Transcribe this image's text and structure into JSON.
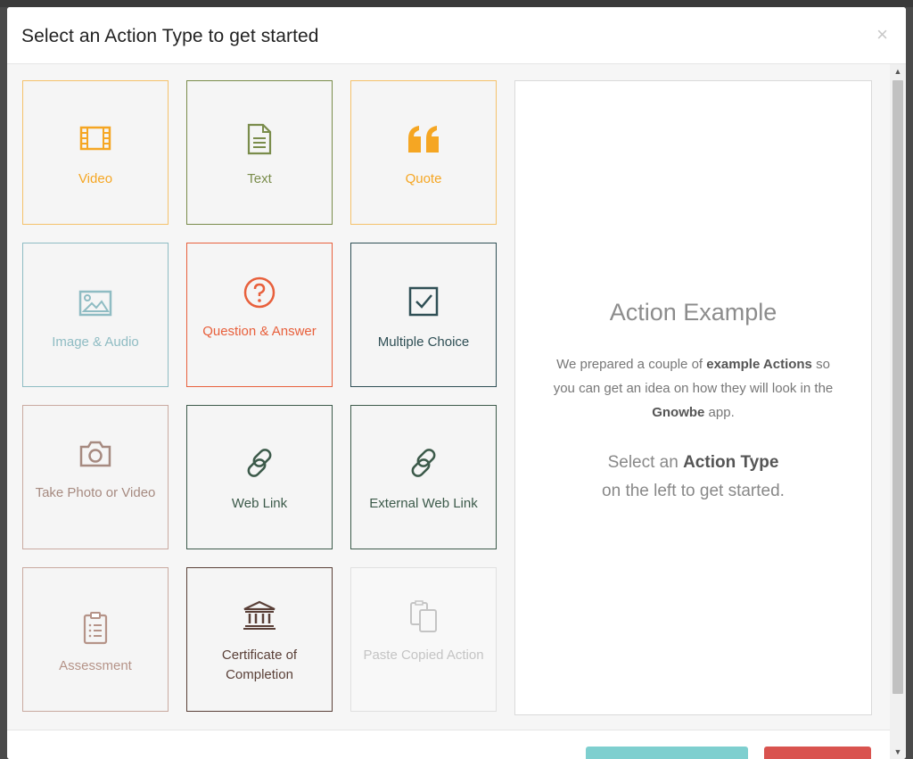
{
  "modal": {
    "title": "Select an Action Type to get started",
    "close_symbol": "×"
  },
  "action_types": [
    {
      "label": "Video",
      "icon": "film-icon",
      "color": "#f5a623"
    },
    {
      "label": "Text",
      "icon": "document-icon",
      "color": "#7a8c4b"
    },
    {
      "label": "Quote",
      "icon": "quote-icon",
      "color": "#f5a623"
    },
    {
      "label": "Image & Audio",
      "icon": "image-icon",
      "color": "#8fbcc3"
    },
    {
      "label": "Question & Answer",
      "icon": "question-circle-icon",
      "color": "#e8603c"
    },
    {
      "label": "Multiple Choice",
      "icon": "checkbox-icon",
      "color": "#2f4f55"
    },
    {
      "label": "Take Photo or Video",
      "icon": "camera-icon",
      "color": "#a68a80"
    },
    {
      "label": "Web Link",
      "icon": "link-icon",
      "color": "#3c5a4a"
    },
    {
      "label": "External Web Link",
      "icon": "link-icon",
      "color": "#3c5a4a"
    },
    {
      "label": "Assessment",
      "icon": "clipboard-icon",
      "color": "#b59388"
    },
    {
      "label": "Certificate of Completion",
      "icon": "institution-icon",
      "color": "#5a4038"
    },
    {
      "label": "Paste Copied Action",
      "icon": "clipboard-copy-icon",
      "color": "#c4c4c4"
    }
  ],
  "preview": {
    "title": "Action Example",
    "desc_1": "We prepared a couple of ",
    "desc_b1": "example Actions",
    "desc_2": " so you can get an idea on how they will look in the ",
    "desc_b2": "Gnowbe",
    "desc_3": " app.",
    "cta_1": "Select an ",
    "cta_b": "Action Type",
    "cta_2": "on the left to get started."
  },
  "scrollbar": {
    "up": "▲",
    "down": "▼"
  },
  "footer": {
    "primary_color": "#7ecfcf",
    "danger_color": "#d9534f"
  }
}
